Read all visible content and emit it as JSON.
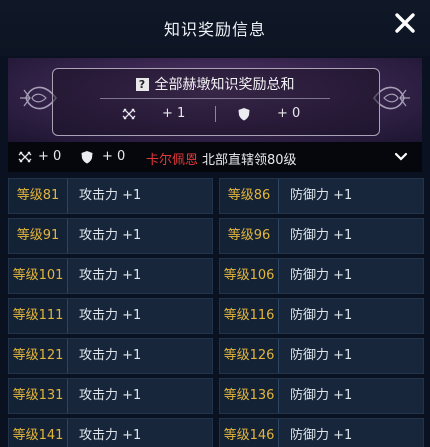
{
  "header": {
    "title": "知识奖励信息"
  },
  "banner": {
    "title": "全部赫墩知识奖励总和",
    "attack_value": "+ 1",
    "defense_value": "+ 0"
  },
  "summary": {
    "attack_value": "+ 0",
    "defense_value": "+ 0",
    "region_highlight": "卡尔佩恩",
    "region_rest": "北部直辖领80级"
  },
  "rewards": [
    {
      "left_level": "等级81",
      "left_effect": "攻击力 +1",
      "right_level": "等级86",
      "right_effect": "防御力 +1"
    },
    {
      "left_level": "等级91",
      "left_effect": "攻击力 +1",
      "right_level": "等级96",
      "right_effect": "防御力 +1"
    },
    {
      "left_level": "等级101",
      "left_effect": "攻击力 +1",
      "right_level": "等级106",
      "right_effect": "防御力 +1"
    },
    {
      "left_level": "等级111",
      "left_effect": "攻击力 +1",
      "right_level": "等级116",
      "right_effect": "防御力 +1"
    },
    {
      "left_level": "等级121",
      "left_effect": "攻击力 +1",
      "right_level": "等级126",
      "right_effect": "防御力 +1"
    },
    {
      "left_level": "等级131",
      "left_effect": "攻击力 +1",
      "right_level": "等级136",
      "right_effect": "防御力 +1"
    },
    {
      "left_level": "等级141",
      "left_effect": "攻击力 +1",
      "right_level": "等级146",
      "right_effect": "防御力 +1"
    }
  ],
  "icons": {
    "close": "close-icon",
    "attack": "crossed-swords-icon",
    "defense": "shield-icon",
    "expand": "chevron-down-icon",
    "question": "question-icon"
  },
  "colors": {
    "level_text": "#e3b53a",
    "highlight_red": "#e23a3a"
  }
}
